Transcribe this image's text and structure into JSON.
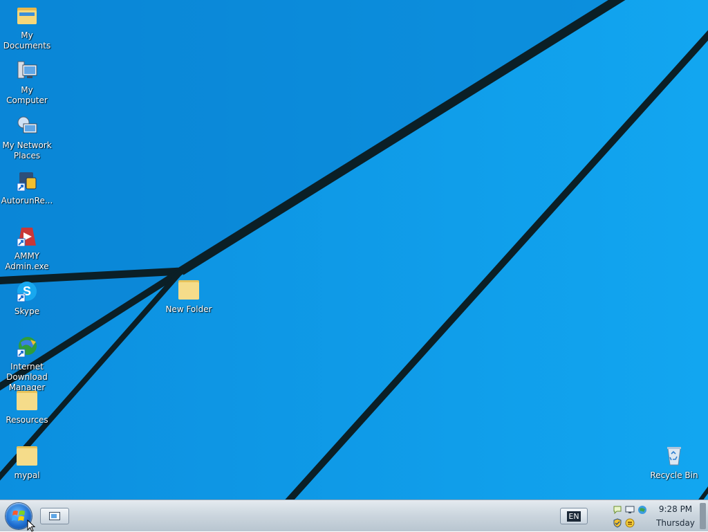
{
  "desktop": {
    "icons": [
      {
        "name": "my-documents",
        "label": "My\nDocuments",
        "icon": "folder-documents-icon"
      },
      {
        "name": "my-computer",
        "label": "My Computer",
        "icon": "computer-icon"
      },
      {
        "name": "my-network-places",
        "label": "My Network\nPlaces",
        "icon": "network-icon"
      },
      {
        "name": "autorun",
        "label": "AutorunRe...",
        "icon": "autorun-shortcut-icon"
      },
      {
        "name": "ammy-admin",
        "label": "AMMY\nAdmin.exe",
        "icon": "ammy-admin-icon"
      },
      {
        "name": "skype",
        "label": "Skype",
        "icon": "skype-icon"
      },
      {
        "name": "internet-download-manager",
        "label": "Internet\nDownload\nManager",
        "icon": "idm-icon"
      },
      {
        "name": "resources",
        "label": "Resources",
        "icon": "folder-icon"
      },
      {
        "name": "mypal",
        "label": "mypal",
        "icon": "folder-icon"
      },
      {
        "name": "new-folder",
        "label": "New Folder",
        "icon": "folder-icon"
      },
      {
        "name": "recycle-bin",
        "label": "Recycle Bin",
        "icon": "recycle-bin-icon"
      }
    ]
  },
  "taskbar": {
    "language": "EN",
    "clock": {
      "time": "9:28 PM",
      "day": "Thursday"
    },
    "tray_icons": [
      "speech-bubble-icon",
      "display-icon",
      "globe-network-icon",
      "shield-icon",
      "smiley-icon"
    ]
  },
  "colors": {
    "wallpaper": "#0b8fe0",
    "taskbar": "#cdd7df",
    "label_text": "#ffffff"
  }
}
